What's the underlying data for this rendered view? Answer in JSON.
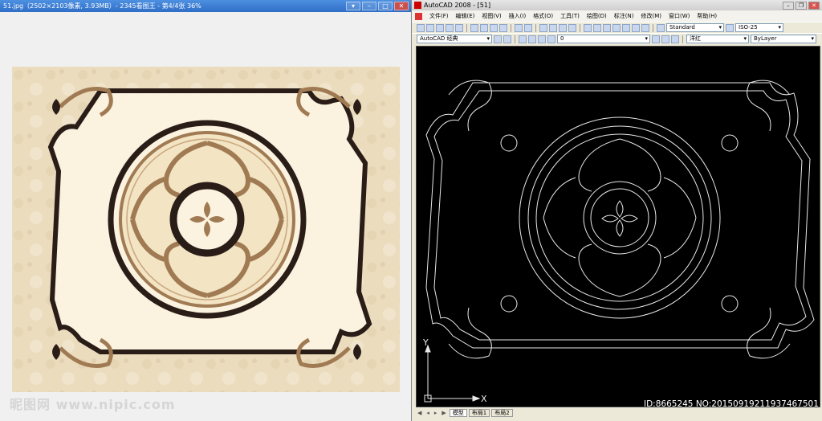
{
  "viewer": {
    "title": "51.jpg（2502×2103像素, 3.93MB）- 2345看图王 - 第4/4张 36%",
    "watermark": "昵图网 www.nipic.com",
    "colors": {
      "background": "#efe3c8",
      "dark": "#2a1d17",
      "brown": "#a07a52",
      "cream": "#fbf3e0"
    }
  },
  "cad": {
    "title": "AutoCAD 2008 - [51]",
    "menu": [
      "文件(F)",
      "编辑(E)",
      "视图(V)",
      "插入(I)",
      "格式(O)",
      "工具(T)",
      "绘图(D)",
      "标注(N)",
      "修改(M)",
      "窗口(W)",
      "帮助(H)"
    ],
    "workspace": "AutoCAD 经典",
    "layer": "0",
    "text_style": "Standard",
    "dim_style": "ISO-25",
    "color": "洋红",
    "linetype": "ByLayer",
    "ucs": {
      "y": "Y",
      "x": "X"
    },
    "tabs": [
      "模型",
      "布局1",
      "布局2"
    ],
    "id_text": "ID:8665245 NO:20150919211937467501"
  }
}
